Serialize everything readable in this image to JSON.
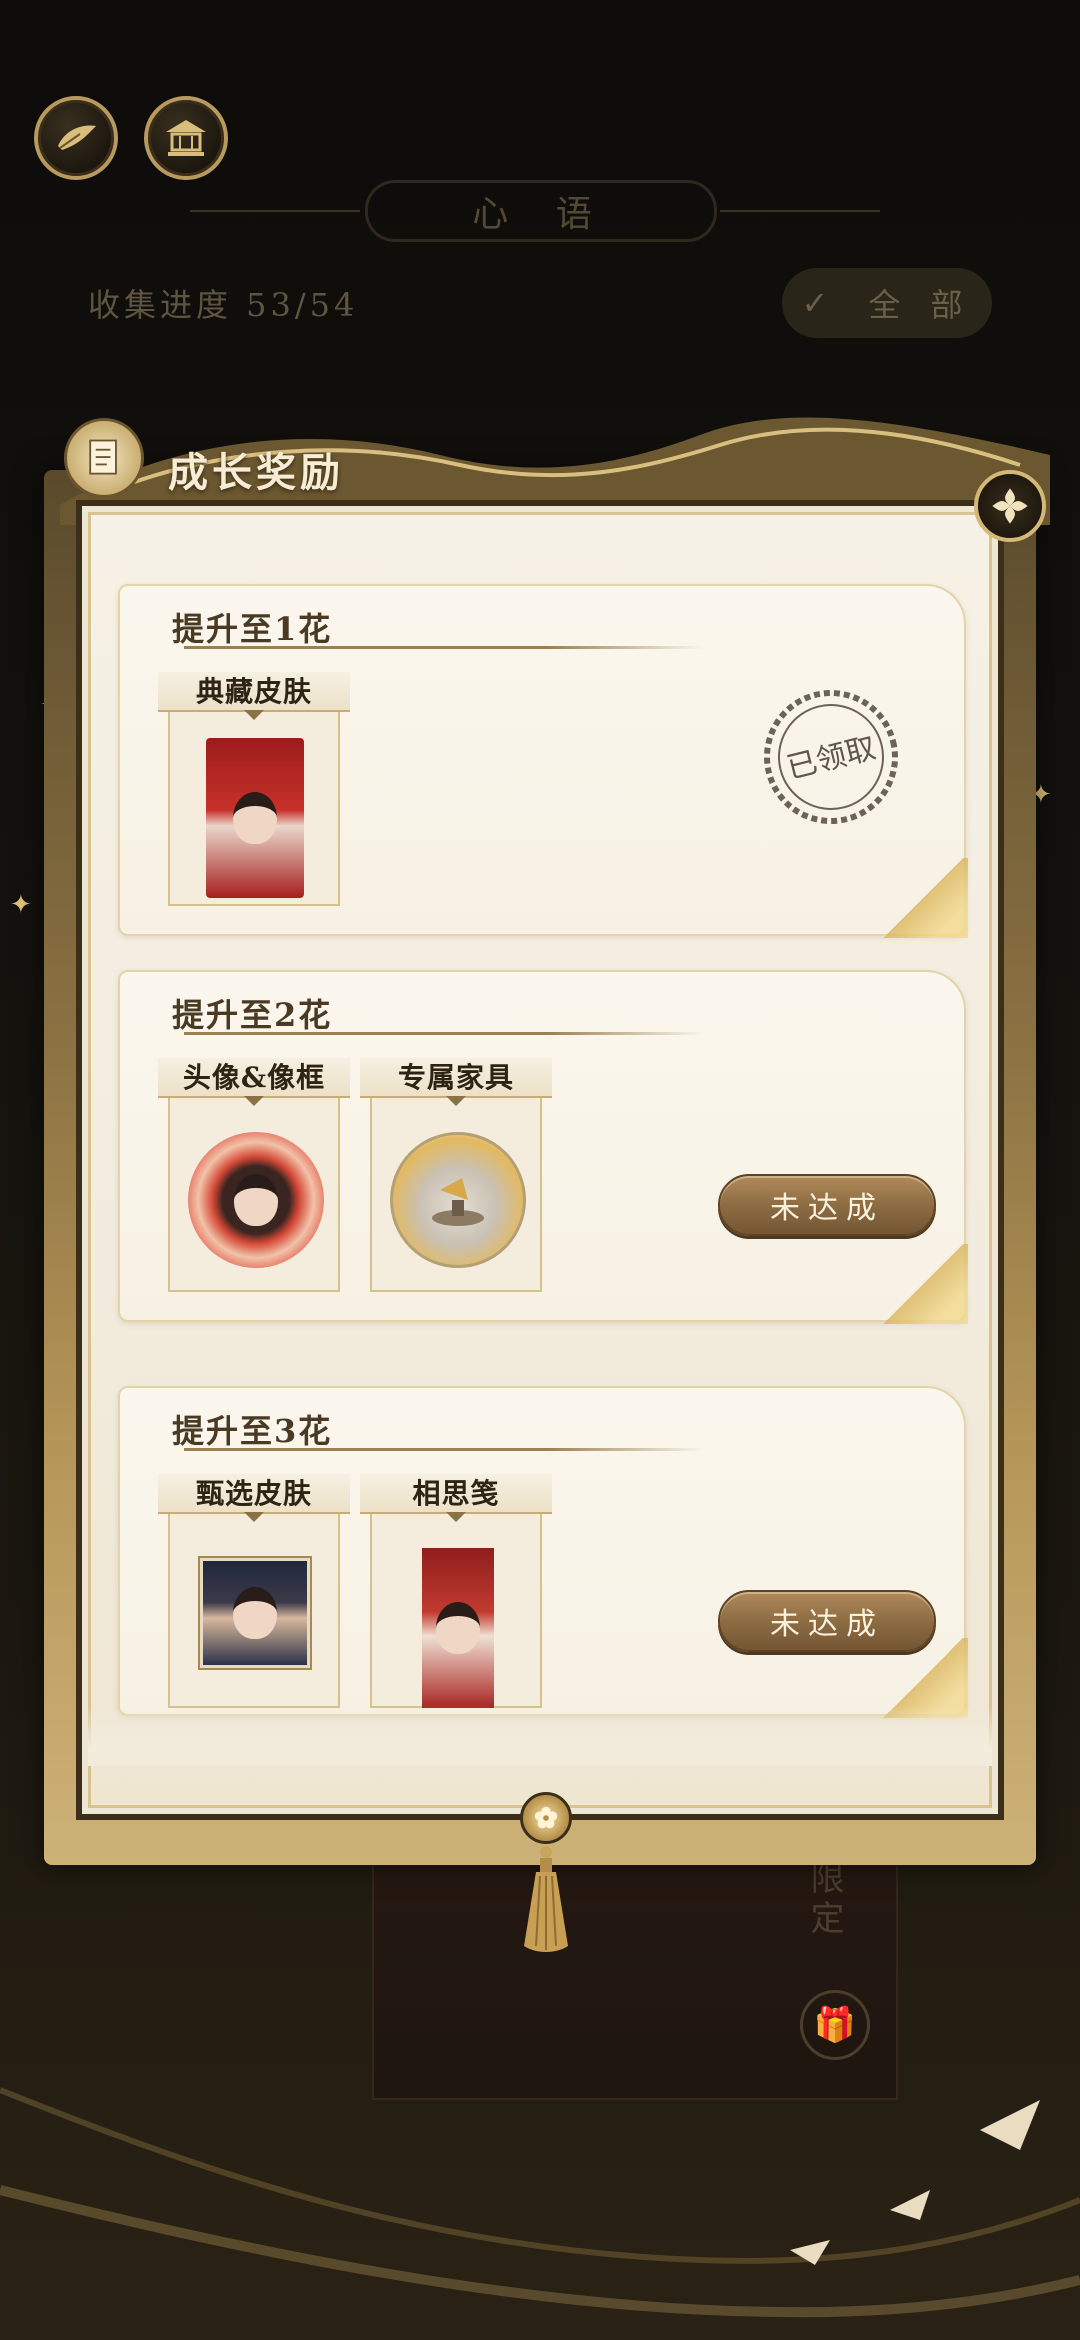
{
  "background": {
    "title": "心 语",
    "progress_label": "收集进度 53/54",
    "filter_label": "全 部",
    "limited_label": "限定"
  },
  "top_icons": [
    {
      "name": "feather-icon"
    },
    {
      "name": "pavilion-icon"
    }
  ],
  "panel": {
    "title": "成长奖励",
    "cards": [
      {
        "title": "提升至1花",
        "rewards": [
          {
            "label": "典藏皮肤",
            "art": "skin"
          }
        ],
        "status": "claimed",
        "stamp_text": "已领取"
      },
      {
        "title": "提升至2花",
        "rewards": [
          {
            "label": "头像&像框",
            "art": "avatar-frame"
          },
          {
            "label": "专属家具",
            "art": "furniture"
          }
        ],
        "status": "pending",
        "button_label": "未达成"
      },
      {
        "title": "提升至3花",
        "rewards": [
          {
            "label": "甄选皮肤",
            "art": "portrait"
          },
          {
            "label": "相思笺",
            "art": "letter"
          }
        ],
        "status": "pending",
        "button_label": "未达成"
      }
    ]
  },
  "colors": {
    "accent_gold": "#b89a5e",
    "panel_bg": "#f6f1e6",
    "button_brown": "#8a6a41",
    "title_text": "#4a3a22"
  }
}
